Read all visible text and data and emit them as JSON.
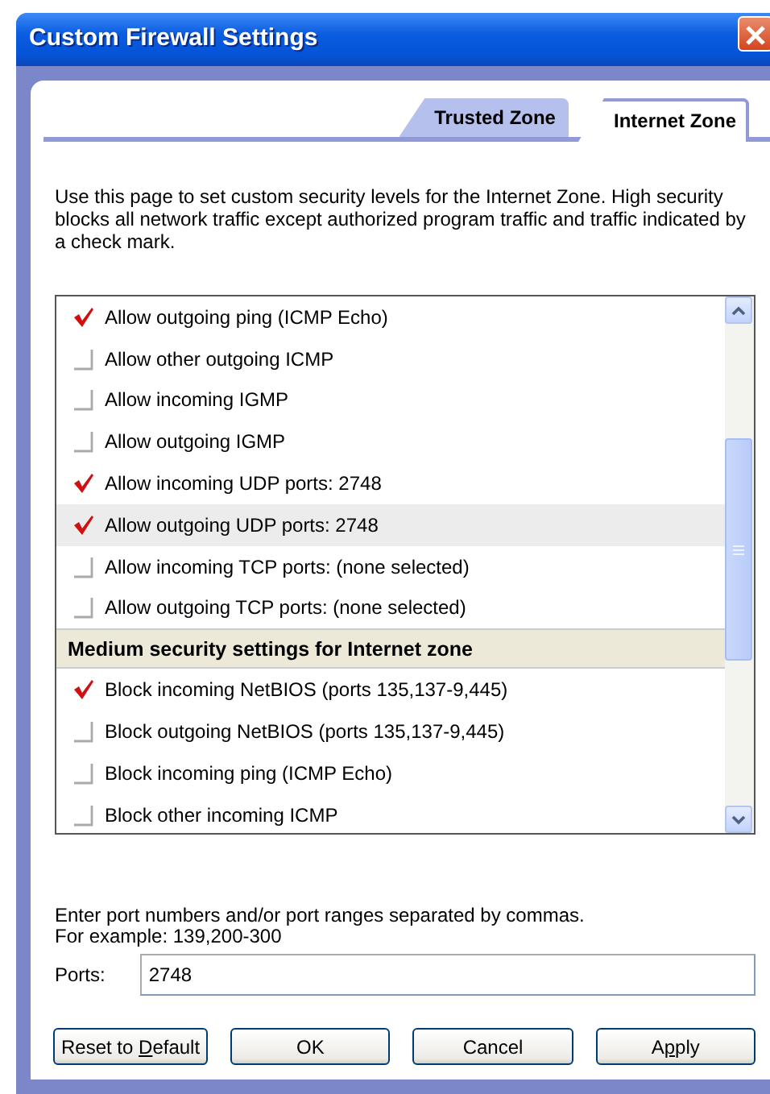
{
  "window": {
    "title": "Custom Firewall Settings"
  },
  "tabs": [
    {
      "label": "Trusted Zone",
      "selected": false
    },
    {
      "label": "Internet Zone",
      "selected": true
    }
  ],
  "description": "Use this page to set custom security levels for the Internet Zone.  High security blocks all network traffic except authorized program traffic and traffic indicated by a check mark.",
  "settings": [
    {
      "kind": "option",
      "label": "Allow outgoing ping (ICMP Echo)",
      "checked": true,
      "selected": false
    },
    {
      "kind": "option",
      "label": "Allow other outgoing ICMP",
      "checked": false,
      "selected": false
    },
    {
      "kind": "option",
      "label": "Allow incoming IGMP",
      "checked": false,
      "selected": false
    },
    {
      "kind": "option",
      "label": "Allow outgoing IGMP",
      "checked": false,
      "selected": false
    },
    {
      "kind": "option",
      "label": "Allow incoming UDP ports: 2748",
      "checked": true,
      "selected": false
    },
    {
      "kind": "option",
      "label": "Allow outgoing UDP ports: 2748",
      "checked": true,
      "selected": true
    },
    {
      "kind": "option",
      "label": "Allow incoming TCP ports: (none selected)",
      "checked": false,
      "selected": false
    },
    {
      "kind": "option",
      "label": "Allow outgoing TCP ports: (none selected)",
      "checked": false,
      "selected": false
    },
    {
      "kind": "header",
      "label": "Medium security settings for Internet zone"
    },
    {
      "kind": "option",
      "label": "Block incoming NetBIOS (ports 135,137-9,445)",
      "checked": true,
      "selected": false
    },
    {
      "kind": "option",
      "label": "Block outgoing NetBIOS (ports 135,137-9,445)",
      "checked": false,
      "selected": false
    },
    {
      "kind": "option",
      "label": "Block incoming ping (ICMP Echo)",
      "checked": false,
      "selected": false
    },
    {
      "kind": "option",
      "label": "Block other incoming ICMP",
      "checked": false,
      "selected": false
    }
  ],
  "hint": [
    "Enter port numbers and/or port ranges separated by commas.",
    "For example: 139,200-300"
  ],
  "ports": {
    "label": "Ports:",
    "value": "2748"
  },
  "buttons": [
    {
      "pre": "Reset to ",
      "key": "D",
      "post": "efault"
    },
    {
      "pre": "OK"
    },
    {
      "pre": "Cancel"
    },
    {
      "pre": "A",
      "key": "p",
      "post": "ply"
    }
  ]
}
